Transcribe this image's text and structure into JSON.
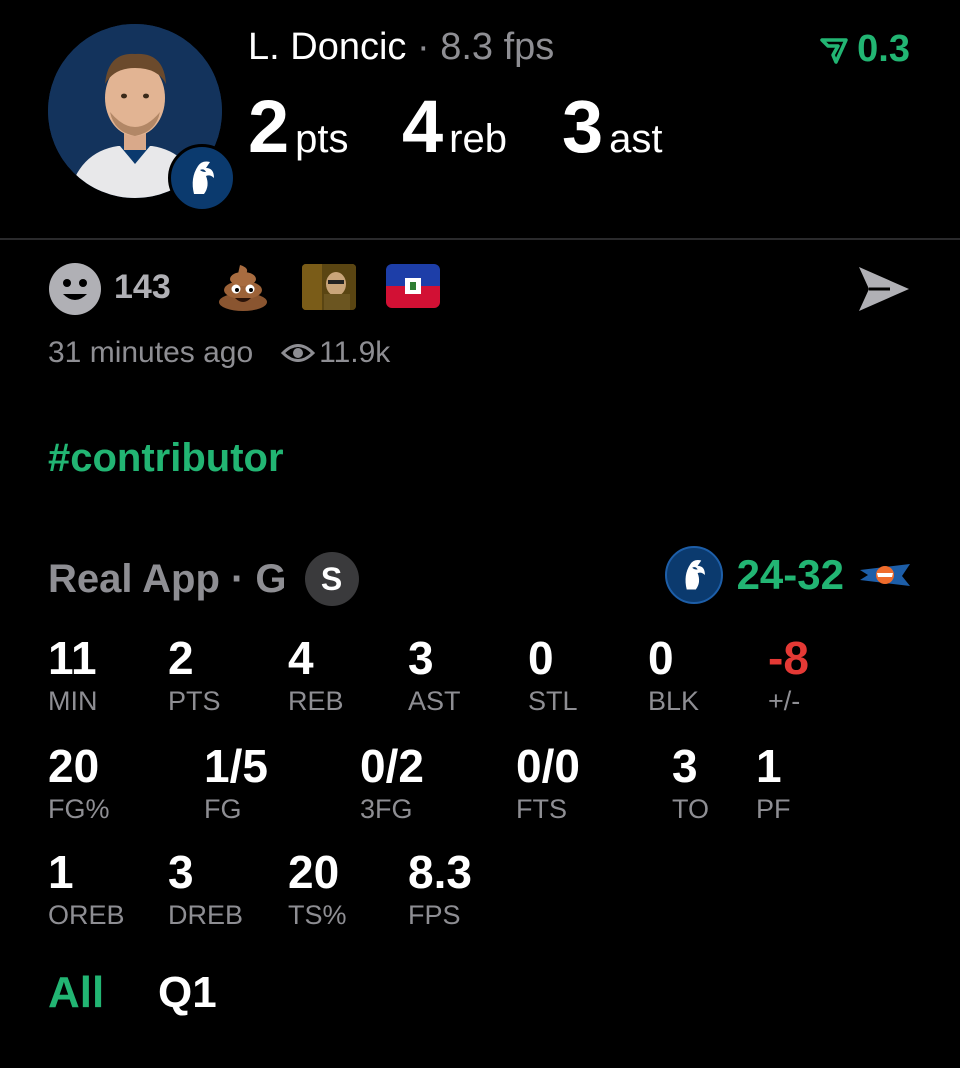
{
  "player": {
    "name": "L. Doncic",
    "fps_label": "8.3 fps",
    "trend_value": "0.3",
    "avatar_icon": "player-photo",
    "team_icon": "mavericks-logo"
  },
  "headline_stats": [
    {
      "value": "2",
      "unit": "pts"
    },
    {
      "value": "4",
      "unit": "reb"
    },
    {
      "value": "3",
      "unit": "ast"
    }
  ],
  "reactions": {
    "count": "143",
    "items": [
      "poop-emoji",
      "reaction-image",
      "haiti-flag"
    ]
  },
  "post": {
    "time_ago": "31 minutes ago",
    "views": "11.9k",
    "hashtag": "#contributor"
  },
  "game": {
    "source": "Real App · G",
    "badge": "S",
    "score": "24-32",
    "home_logo": "mavericks-logo",
    "away_logo": "okc-thunder-logo"
  },
  "stats_row1": [
    {
      "value": "11",
      "label": "MIN"
    },
    {
      "value": "2",
      "label": "PTS"
    },
    {
      "value": "4",
      "label": "REB"
    },
    {
      "value": "3",
      "label": "AST"
    },
    {
      "value": "0",
      "label": "STL"
    },
    {
      "value": "0",
      "label": "BLK"
    },
    {
      "value": "-8",
      "label": "+/-"
    }
  ],
  "stats_row2": [
    {
      "value": "20",
      "label": "FG%"
    },
    {
      "value": "1/5",
      "label": "FG"
    },
    {
      "value": "0/2",
      "label": "3FG"
    },
    {
      "value": "0/0",
      "label": "FTS"
    },
    {
      "value": "3",
      "label": "TO"
    },
    {
      "value": "1",
      "label": "PF"
    }
  ],
  "stats_row3": [
    {
      "value": "1",
      "label": "OREB"
    },
    {
      "value": "3",
      "label": "DREB"
    },
    {
      "value": "20",
      "label": "TS%"
    },
    {
      "value": "8.3",
      "label": "FPS"
    }
  ],
  "tabs": {
    "all": "All",
    "q1": "Q1"
  },
  "colors": {
    "accent_green": "#22b573",
    "negative_red": "#e53935",
    "muted_gray": "#8e8e93"
  }
}
